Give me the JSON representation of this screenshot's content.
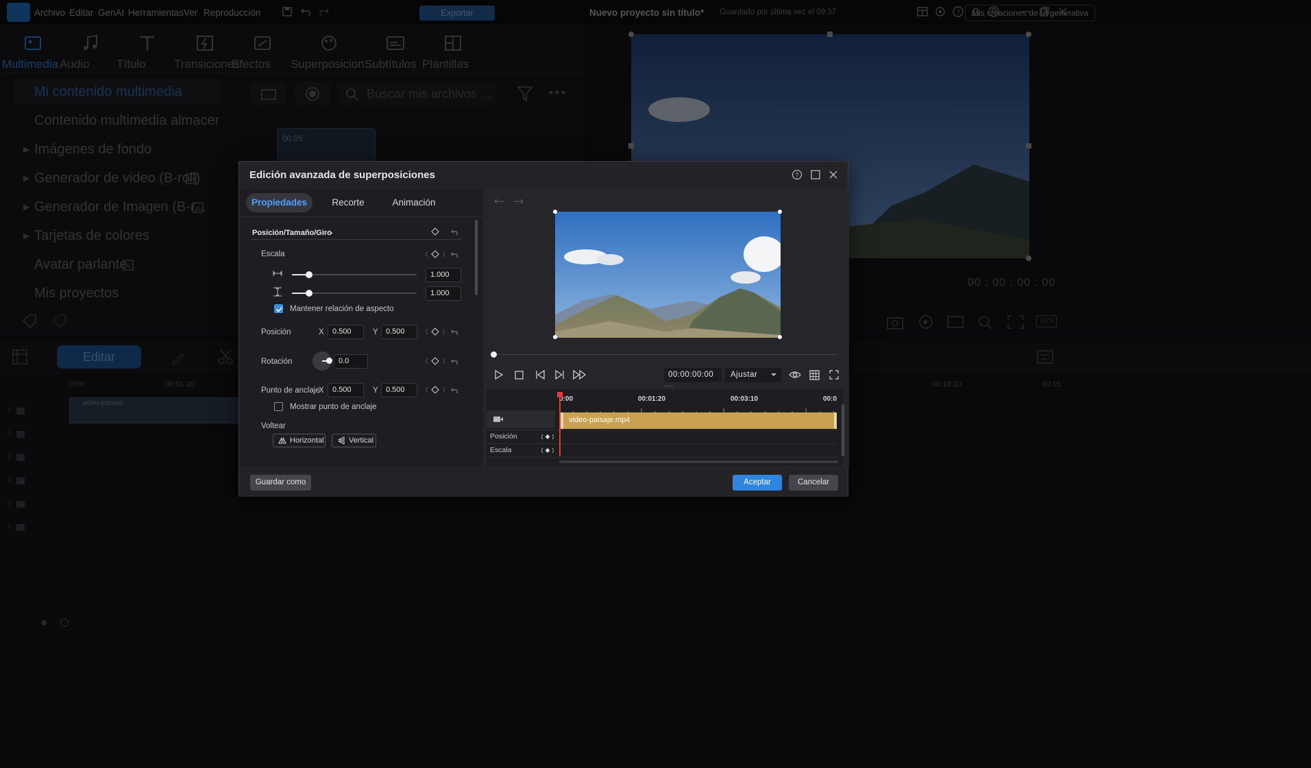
{
  "app": {
    "menu": [
      "Archivo",
      "Editar",
      "GenAI",
      "Herramientas",
      "Ver",
      "Reproducción"
    ],
    "export_label": "Exportar",
    "project_title": "Nuevo proyecto sin título*",
    "saved_text": "Guardado por última vez el 09:37",
    "ai_creations_label": "Mis creaciones de IA generativa"
  },
  "tool_tabs": [
    {
      "label": "Multimedia",
      "icon": "media-icon"
    },
    {
      "label": "Audio",
      "icon": "music-note-icon"
    },
    {
      "label": "Título",
      "icon": "title-t-icon"
    },
    {
      "label": "Transiciones",
      "icon": "transition-icon"
    },
    {
      "label": "Efectos",
      "icon": "effects-icon"
    },
    {
      "label": "Superposicion...",
      "icon": "overlay-icon"
    },
    {
      "label": "Subtítulos",
      "icon": "subtitles-icon"
    },
    {
      "label": "Plantillas",
      "icon": "templates-icon"
    }
  ],
  "media_sidebar": [
    "Mi contenido multimedia",
    "Contenido multimedia almacen...",
    "Imágenes de fondo",
    "Generador de video (B-roll)",
    "Generador de Imagen (B-r...",
    "Tarjetas de colores",
    "Avatar parlante",
    "Mis proyectos"
  ],
  "library": {
    "search_placeholder": "Buscar mis archivos ...",
    "thumb_duration": "00:05"
  },
  "main_preview": {
    "timecode": "00 : 00 : 00 : 00",
    "aspect": "16:9"
  },
  "timeline": {
    "edit_label": "Editar",
    "ruler": [
      "0:00",
      "00:01:20",
      "00:13:10",
      "00:15:"
    ],
    "clip_label": "video-paisaje",
    "track_numbers": [
      "1",
      "1",
      "2",
      "2",
      "3",
      "3"
    ]
  },
  "dialog": {
    "title": "Edición avanzada de superposiciones",
    "tabs": [
      "Propiedades",
      "Recorte",
      "Animación"
    ],
    "section_title": "Posición/Tamaño/Giro",
    "scale_label": "Escala",
    "scale_width": "1.000",
    "scale_height": "1.000",
    "scale_ratio": 0.14,
    "keep_aspect_label": "Mantener relación de aspecto",
    "keep_aspect_checked": true,
    "position_label": "Posición",
    "x_label": "X",
    "y_label": "Y",
    "position_x": "0.500",
    "position_y": "0.500",
    "rotation_label": "Rotación",
    "rotation_value": "0.0",
    "anchor_label": "Punto de anclaje",
    "anchor_x": "0.500",
    "anchor_y": "0.500",
    "show_anchor_label": "Mostrar punto de anclaje",
    "show_anchor_checked": false,
    "flip_label": "Voltear",
    "flip_horizontal": "Horizontal",
    "flip_vertical": "Vertical",
    "preview_timecode": "00:00:00:00",
    "fit_option": "Ajustar",
    "kf_ruler": [
      "0:00",
      "00:01:20",
      "00:03:10",
      "00:0"
    ],
    "kf_clip_name": "video-paisaje.mp4",
    "kf_rows": [
      "Posición",
      "Escala"
    ],
    "save_as_label": "Guardar como",
    "accept_label": "Aceptar",
    "cancel_label": "Cancelar"
  },
  "colors": {
    "accent": "#2f86e0",
    "clip": "#c9a150",
    "playhead": "#e03a3a"
  }
}
